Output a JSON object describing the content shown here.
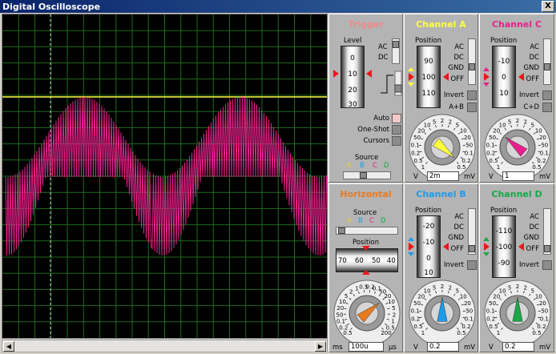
{
  "window": {
    "title": "Digital Oscilloscope",
    "close_label": "X"
  },
  "colors": {
    "channel_a": "#ffff40",
    "channel_b": "#1e9be8",
    "channel_c": "#e8208c",
    "channel_d": "#18a848",
    "trigger_title": "#f08a8a",
    "horizontal_title": "#e87a20",
    "screen_bg": "#000000",
    "grid": "#1e6a1e"
  },
  "trigger": {
    "title": "Trigger",
    "level_label": "Level",
    "level_ticks": [
      "0",
      "10",
      "20",
      "30"
    ],
    "ac": "AC",
    "dc": "DC",
    "auto": "Auto",
    "one_shot": "One-Shot",
    "cursors": "Cursors",
    "source_label": "Source",
    "sources": [
      "A",
      "B",
      "C",
      "D"
    ]
  },
  "channel_a": {
    "title": "Channel A",
    "position_label": "Position",
    "position_ticks": [
      "90",
      "100",
      "110"
    ],
    "modes": [
      "AC",
      "DC",
      "GND",
      "OFF"
    ],
    "invert": "Invert",
    "combine": "A+B",
    "dial_scale": [
      "0.2",
      "0.5",
      "1",
      "2",
      "5",
      "10",
      "20",
      "50",
      "0.1",
      "0.2",
      "0.5",
      "1",
      "2",
      "5",
      "10",
      "20"
    ],
    "unit_left": "V",
    "unit_right": "mV",
    "value": "2m"
  },
  "channel_c": {
    "title": "Channel C",
    "position_label": "Position",
    "position_ticks": [
      "-10",
      "0",
      "10"
    ],
    "modes": [
      "AC",
      "DC",
      "GND",
      "OFF"
    ],
    "invert": "Invert",
    "combine": "C+D",
    "unit_left": "V",
    "unit_right": "mV",
    "value": "1"
  },
  "horizontal": {
    "title": "Horizontal",
    "source_label": "Source",
    "sources": [
      "A",
      "B",
      "C",
      "D"
    ],
    "position_label": "Position",
    "position_ticks": [
      "70",
      "60",
      "50",
      "40"
    ],
    "unit_left": "ms",
    "unit_right": "µs",
    "value": "100u"
  },
  "channel_b": {
    "title": "Channel B",
    "position_label": "Position",
    "position_ticks": [
      "-20",
      "-10",
      "0",
      "10"
    ],
    "modes": [
      "AC",
      "DC",
      "GND",
      "OFF"
    ],
    "invert": "Invert",
    "unit_left": "V",
    "unit_right": "mV",
    "value": "0.2"
  },
  "channel_d": {
    "title": "Channel D",
    "position_label": "Position",
    "position_ticks": [
      "-110",
      "-100",
      "-90"
    ],
    "modes": [
      "AC",
      "DC",
      "GND",
      "OFF"
    ],
    "invert": "Invert",
    "unit_left": "V",
    "unit_right": "mV",
    "value": "0.2"
  },
  "dial_numbers": {
    "voltage": [
      "1",
      "0.5",
      "0.2",
      "0.1",
      "50",
      "20",
      "10",
      "5",
      "2",
      "2",
      "5",
      "10",
      "20",
      "50",
      "0.1",
      "0.2",
      "0.5"
    ],
    "time": [
      "0.5",
      "0.2",
      "0.1",
      "50",
      "20",
      "10",
      "5",
      "2",
      "1",
      "0.5",
      "0.2",
      "0.1",
      "50",
      "20",
      "10",
      "5",
      "2",
      "1",
      "0.5",
      "200"
    ]
  }
}
